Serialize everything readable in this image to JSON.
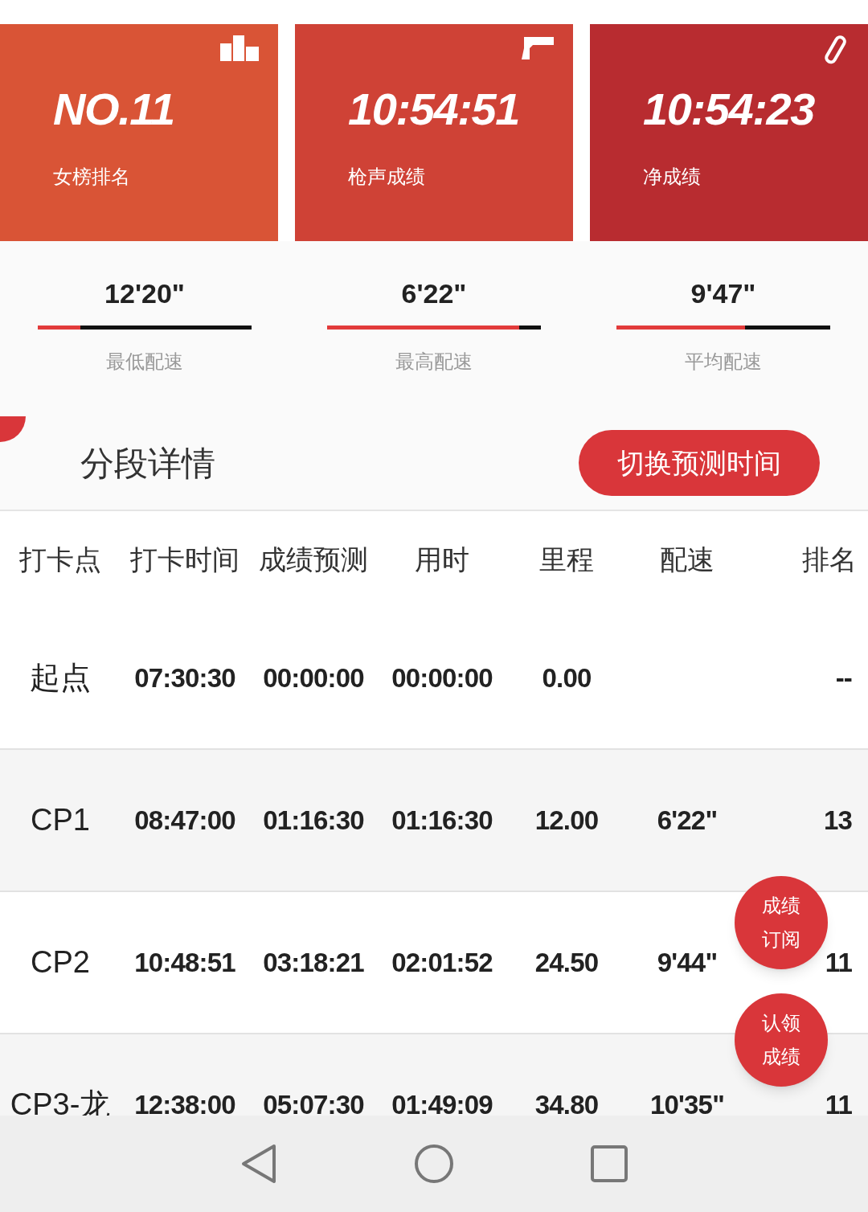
{
  "cards": [
    {
      "kind": "rank",
      "value": "NO.11",
      "label": "女榜排名",
      "color": "#d95436"
    },
    {
      "kind": "gun",
      "value": "10:54:51",
      "label": "枪声成绩",
      "color": "#cf4236"
    },
    {
      "kind": "net",
      "value": "10:54:23",
      "label": "净成绩",
      "color": "#b82c30"
    }
  ],
  "paces": [
    {
      "value": "12'20\"",
      "label": "最低配速",
      "level": 0.2
    },
    {
      "value": "6'22\"",
      "label": "最高配速",
      "level": 0.9
    },
    {
      "value": "9'47\"",
      "label": "平均配速",
      "level": 0.6
    }
  ],
  "section": {
    "title": "分段详情",
    "button": "切换预测时间"
  },
  "table": {
    "columns": [
      "打卡点",
      "打卡时间",
      "成绩预测",
      "用时",
      "里程",
      "配速",
      "排名"
    ],
    "rows": [
      {
        "cells": [
          "起点",
          "07:30:30",
          "00:00:00",
          "00:00:00",
          "0.00",
          "",
          "--"
        ]
      },
      {
        "cells": [
          "CP1",
          "08:47:00",
          "01:16:30",
          "01:16:30",
          "12.00",
          "6'22\"",
          "13"
        ]
      },
      {
        "cells": [
          "CP2",
          "10:48:51",
          "03:18:21",
          "02:01:52",
          "24.50",
          "9'44\"",
          "11"
        ]
      },
      {
        "cells": [
          "CP3-龙",
          "12:38:00",
          "05:07:30",
          "01:49:09",
          "34.80",
          "10'35\"",
          "11"
        ]
      }
    ]
  },
  "fabs": [
    [
      "成绩",
      "订阅"
    ],
    [
      "认领",
      "成绩"
    ]
  ]
}
